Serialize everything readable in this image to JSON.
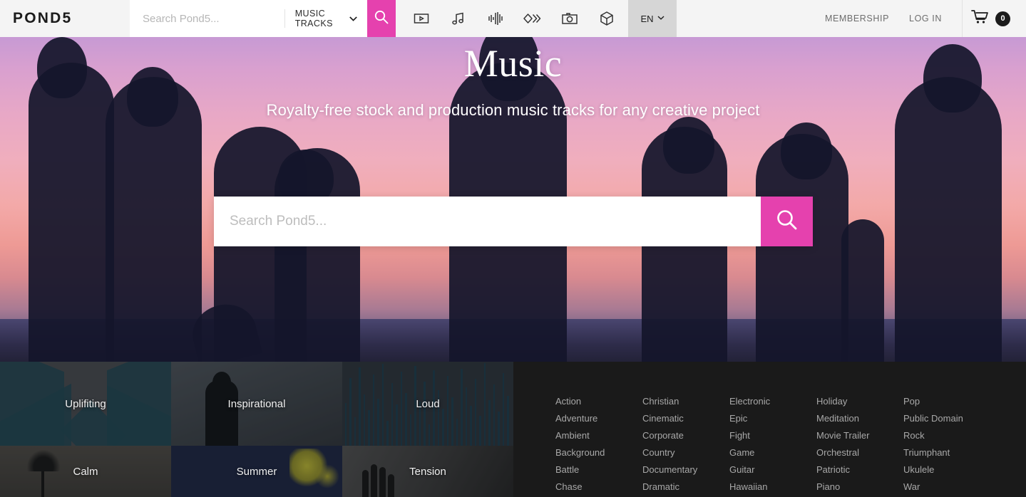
{
  "brand": {
    "logo_text": "POND5",
    "accent_color": "#e541ae"
  },
  "topnav": {
    "search_placeholder": "Search Pond5...",
    "search_value": "",
    "category_selected": "MUSIC TRACKS",
    "icons": [
      {
        "name": "video-icon",
        "label": "Video"
      },
      {
        "name": "music-note-icon",
        "label": "Music"
      },
      {
        "name": "sound-effects-icon",
        "label": "Sound Effects"
      },
      {
        "name": "after-effects-icon",
        "label": "After Effects"
      },
      {
        "name": "photo-camera-icon",
        "label": "Photos"
      },
      {
        "name": "3d-cube-icon",
        "label": "3D Models"
      }
    ],
    "language": "EN",
    "membership_label": "MEMBERSHIP",
    "login_label": "LOG IN",
    "cart_count": "0"
  },
  "hero": {
    "title": "Music",
    "subtitle": "Royalty-free stock and production music tracks for any creative project",
    "search_placeholder": "Search Pond5...",
    "search_value": "",
    "search_button_icon": "search-icon"
  },
  "tiles": [
    {
      "label": "Uplifiting"
    },
    {
      "label": "Inspirational"
    },
    {
      "label": "Loud"
    },
    {
      "label": "Calm"
    },
    {
      "label": "Summer"
    },
    {
      "label": "Tension"
    }
  ],
  "categories": {
    "columns": [
      [
        "Action",
        "Adventure",
        "Ambient",
        "Background",
        "Battle",
        "Chase"
      ],
      [
        "Christian",
        "Cinematic",
        "Corporate",
        "Country",
        "Documentary",
        "Dramatic"
      ],
      [
        "Electronic",
        "Epic",
        "Fight",
        "Game",
        "Guitar",
        "Hawaiian"
      ],
      [
        "Holiday",
        "Meditation",
        "Movie Trailer",
        "Orchestral",
        "Patriotic",
        "Piano"
      ],
      [
        "Pop",
        "Public Domain",
        "Rock",
        "Triumphant",
        "Ukulele",
        "War"
      ]
    ]
  }
}
